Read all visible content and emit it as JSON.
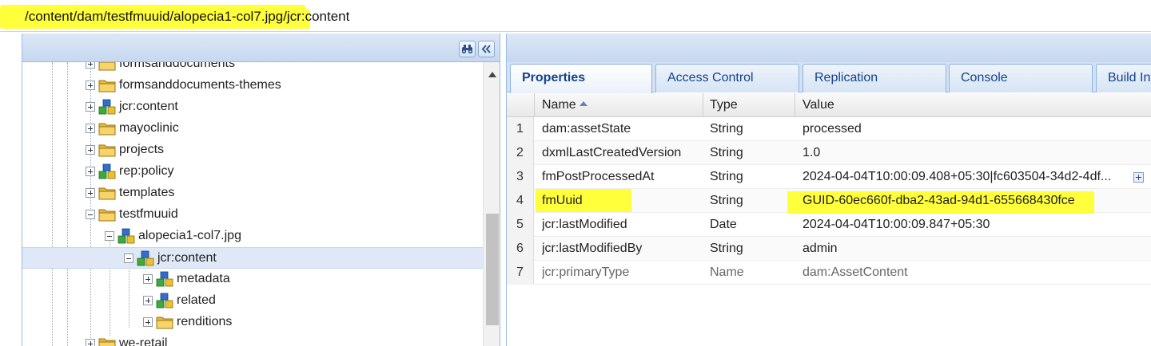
{
  "address_bar": {
    "highlighted_path": "/content/dam/testfmuuid/alopecia1-col7.jpg/",
    "suffix": "jcr:content"
  },
  "tree": {
    "nodes": [
      {
        "label": "formsanddocuments",
        "icon": "folder-icon",
        "expander": "plus"
      },
      {
        "label": "formsanddocuments-themes",
        "icon": "folder-icon",
        "expander": "plus"
      },
      {
        "label": "jcr:content",
        "icon": "node-icon",
        "expander": "plus"
      },
      {
        "label": "mayoclinic",
        "icon": "folder-icon",
        "expander": "plus"
      },
      {
        "label": "projects",
        "icon": "folder-icon",
        "expander": "plus"
      },
      {
        "label": "rep:policy",
        "icon": "node-icon",
        "expander": "plus"
      },
      {
        "label": "templates",
        "icon": "folder-icon",
        "expander": "plus"
      },
      {
        "label": "testfmuuid",
        "icon": "folder-icon",
        "expander": "minus"
      },
      {
        "label": "alopecia1-col7.jpg",
        "icon": "node-icon",
        "expander": "minus"
      },
      {
        "label": "jcr:content",
        "icon": "node-icon",
        "expander": "minus",
        "selected": true
      },
      {
        "label": "metadata",
        "icon": "node-icon",
        "expander": "plus"
      },
      {
        "label": "related",
        "icon": "node-icon",
        "expander": "plus"
      },
      {
        "label": "renditions",
        "icon": "folder-icon",
        "expander": "plus"
      },
      {
        "label": "we-retail",
        "icon": "folder-icon",
        "expander": "plus"
      }
    ]
  },
  "tabs": [
    {
      "label": "Properties",
      "active": true
    },
    {
      "label": "Access Control"
    },
    {
      "label": "Replication"
    },
    {
      "label": "Console"
    },
    {
      "label": "Build Info"
    }
  ],
  "grid": {
    "columns": {
      "name": "Name",
      "type": "Type",
      "value": "Value"
    },
    "rows": [
      {
        "num": "1",
        "name": "dam:assetState",
        "type": "String",
        "value": "processed"
      },
      {
        "num": "2",
        "name": "dxmlLastCreatedVersion",
        "type": "String",
        "value": "1.0"
      },
      {
        "num": "3",
        "name": "fmPostProcessedAt",
        "type": "String",
        "value": "2024-04-04T10:00:09.408+05:30|fc603504-34d2-4df..."
      },
      {
        "num": "4",
        "name": "fmUuid",
        "type": "String",
        "value": "GUID-60ec660f-dba2-43ad-94d1-655668430fce"
      },
      {
        "num": "5",
        "name": "jcr:lastModified",
        "type": "Date",
        "value": "2024-04-04T10:00:09.847+05:30"
      },
      {
        "num": "6",
        "name": "jcr:lastModifiedBy",
        "type": "String",
        "value": "admin"
      },
      {
        "num": "7",
        "name": "jcr:primaryType",
        "type": "Name",
        "value": "dam:AssetContent"
      }
    ]
  },
  "colors": {
    "highlight": "#ffff3c",
    "panel_header": "#c6d8f0",
    "tab_text": "#15428b",
    "selected_row": "#dfe8f6"
  }
}
